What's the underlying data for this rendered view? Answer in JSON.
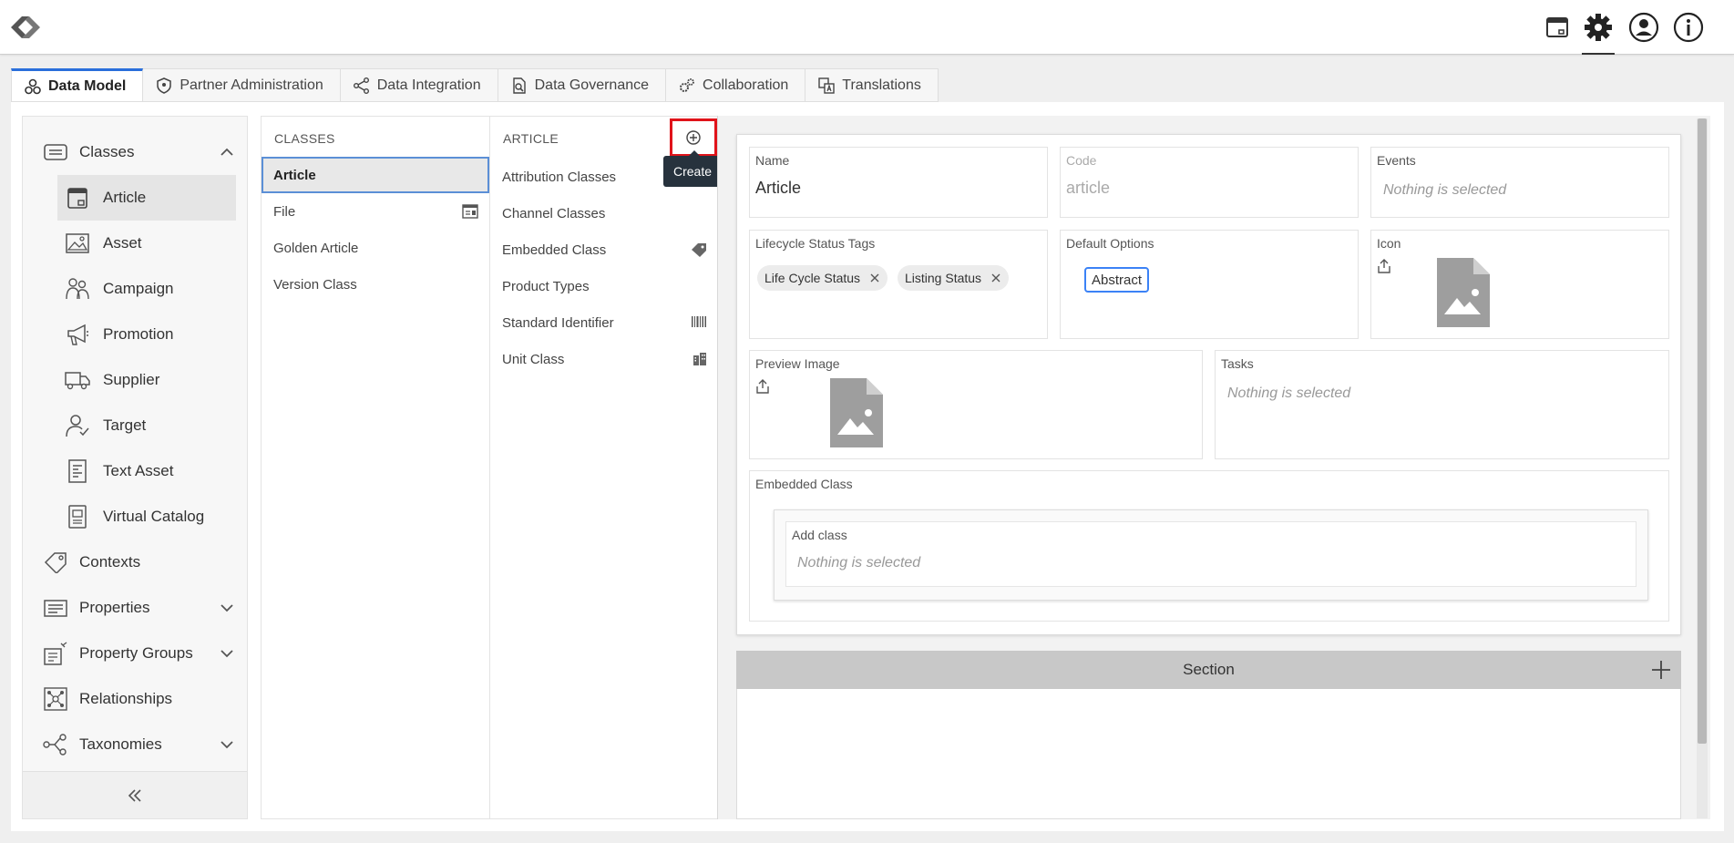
{
  "header": {
    "icons": [
      "logo-icon",
      "package-icon",
      "gear-icon",
      "user-icon",
      "info-icon"
    ]
  },
  "tabs": [
    {
      "label": "Data Model",
      "icon": "data-model-icon",
      "active": true
    },
    {
      "label": "Partner Administration",
      "icon": "shield-icon"
    },
    {
      "label": "Data Integration",
      "icon": "share-icon"
    },
    {
      "label": "Data Governance",
      "icon": "document-search-icon"
    },
    {
      "label": "Collaboration",
      "icon": "gears-icon"
    },
    {
      "label": "Translations",
      "icon": "translate-icon"
    }
  ],
  "sidebar": {
    "items": [
      {
        "label": "Classes",
        "icon": "classes-icon",
        "expanded": true
      },
      {
        "label": "Article",
        "icon": "article-icon",
        "selected": true
      },
      {
        "label": "Asset",
        "icon": "asset-icon"
      },
      {
        "label": "Campaign",
        "icon": "campaign-icon"
      },
      {
        "label": "Promotion",
        "icon": "megaphone-icon"
      },
      {
        "label": "Supplier",
        "icon": "truck-icon"
      },
      {
        "label": "Target",
        "icon": "target-user-icon"
      },
      {
        "label": "Text Asset",
        "icon": "text-asset-icon"
      },
      {
        "label": "Virtual Catalog",
        "icon": "catalog-icon"
      },
      {
        "label": "Contexts",
        "icon": "tag-icon"
      },
      {
        "label": "Properties",
        "icon": "properties-icon"
      },
      {
        "label": "Property Groups",
        "icon": "property-groups-icon"
      },
      {
        "label": "Relationships",
        "icon": "relationships-icon"
      },
      {
        "label": "Taxonomies",
        "icon": "taxonomies-icon"
      }
    ]
  },
  "classes_column": {
    "title": "CLASSES",
    "items": [
      "Article",
      "File",
      "Golden Article",
      "Version Class"
    ]
  },
  "article_column": {
    "title": "ARTICLE",
    "items": [
      "Attribution Classes",
      "Channel Classes",
      "Embedded Class",
      "Product Types",
      "Standard Identifier",
      "Unit Class"
    ]
  },
  "create_tooltip": "Create",
  "detail": {
    "name_label": "Name",
    "name_value": "Article",
    "code_label": "Code",
    "code_value": "article",
    "events_label": "Events",
    "events_value": "Nothing is selected",
    "lifecycle_label": "Lifecycle Status Tags",
    "lifecycle_tags": [
      "Life Cycle Status",
      "Listing Status"
    ],
    "default_options_label": "Default Options",
    "default_option": "Abstract",
    "icon_label": "Icon",
    "preview_label": "Preview Image",
    "tasks_label": "Tasks",
    "tasks_value": "Nothing is selected",
    "embedded_label": "Embedded Class",
    "add_class_label": "Add class",
    "add_class_value": "Nothing is selected",
    "section_title": "Section"
  },
  "colors": {
    "accent": "#2a6fdb",
    "highlight_border": "#e0131a",
    "tooltip_bg": "#27323d"
  }
}
